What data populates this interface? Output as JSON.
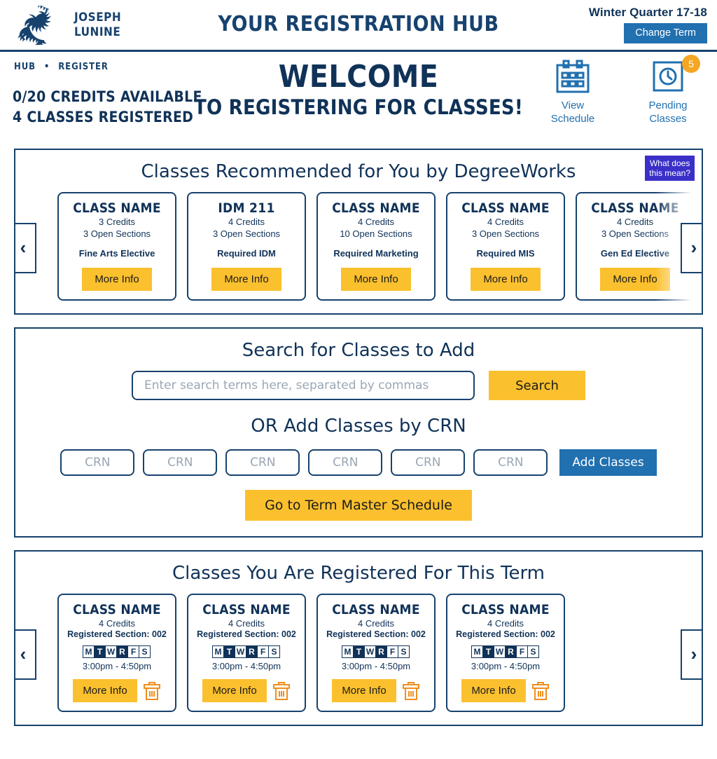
{
  "topbar": {
    "logo_icon": "dragon-logo",
    "brand_line1": "JOSEPH",
    "brand_line2": "LUNINE",
    "app_title": "YOUR REGISTRATION HUB",
    "term": "Winter Quarter 17-18",
    "change_term_label": "Change Term"
  },
  "header": {
    "breadcrumb": {
      "home": "HUB",
      "separator": "•",
      "current": "REGISTER"
    },
    "credits_line1": "0/20 CREDITS AVAILABLE",
    "credits_line2": "4 CLASSES REGISTERED",
    "welcome_line1": "WELCOME",
    "welcome_line2": "TO REGISTERING FOR CLASSES!",
    "quicklinks": [
      {
        "icon": "calendar-icon",
        "label_line1": "View",
        "label_line2": "Schedule",
        "badge": null
      },
      {
        "icon": "clock-icon",
        "label_line1": "Pending",
        "label_line2": "Classes",
        "badge": "5"
      }
    ]
  },
  "recommended": {
    "title": "Classes Recommended for You by DegreeWorks",
    "hint_line1": "What does",
    "hint_line2": "this mean?",
    "prev_label": "‹",
    "next_label": "›",
    "more_info_label": "More Info",
    "cards": [
      {
        "name": "CLASS NAME",
        "credits": "3 Credits",
        "sections": "3 Open Sections",
        "category": "Fine Arts Elective"
      },
      {
        "name": "IDM 211",
        "credits": "4 Credits",
        "sections": "3 Open Sections",
        "category": "Required IDM"
      },
      {
        "name": "CLASS NAME",
        "credits": "4 Credits",
        "sections": "10 Open Sections",
        "category": "Required Marketing"
      },
      {
        "name": "CLASS NAME",
        "credits": "4 Credits",
        "sections": "3 Open Sections",
        "category": "Required MIS"
      },
      {
        "name": "CLASS NAME",
        "credits": "4 Credits",
        "sections": "3 Open Sections",
        "category": "Gen Ed Elective"
      }
    ]
  },
  "search": {
    "title": "Search for Classes to Add",
    "placeholder": "Enter search terms here, separated by commas",
    "value": "",
    "search_label": "Search",
    "crn_title": "OR Add Classes by CRN",
    "crn_placeholder": "CRN",
    "crn_count": 6,
    "add_classes_label": "Add Classes",
    "master_schedule_label": "Go to Term Master Schedule"
  },
  "registered": {
    "title": "Classes You Are Registered For This Term",
    "prev_label": "‹",
    "next_label": "›",
    "more_info_label": "More Info",
    "delete_icon": "trash-icon",
    "day_letters": [
      "M",
      "T",
      "W",
      "R",
      "F",
      "S"
    ],
    "cards": [
      {
        "name": "CLASS NAME",
        "credits": "4 Credits",
        "section_label": "Registered Section:",
        "section": "002",
        "days_active": [
          false,
          true,
          false,
          true,
          false,
          false
        ],
        "time": "3:00pm - 4:50pm"
      },
      {
        "name": "CLASS NAME",
        "credits": "4 Credits",
        "section_label": "Registered Section:",
        "section": "002",
        "days_active": [
          false,
          true,
          false,
          true,
          false,
          false
        ],
        "time": "3:00pm - 4:50pm"
      },
      {
        "name": "CLASS NAME",
        "credits": "4 Credits",
        "section_label": "Registered Section:",
        "section": "002",
        "days_active": [
          false,
          true,
          false,
          true,
          false,
          false
        ],
        "time": "3:00pm - 4:50pm"
      },
      {
        "name": "CLASS NAME",
        "credits": "4 Credits",
        "section_label": "Registered Section:",
        "section": "002",
        "days_active": [
          false,
          true,
          false,
          true,
          false,
          false
        ],
        "time": "3:00pm - 4:50pm"
      }
    ]
  },
  "colors": {
    "navy": "#103258",
    "border_navy": "#17426e",
    "blue_button": "#2170b0",
    "yellow": "#fbc02d",
    "orange": "#f5a623",
    "purple": "#3b2fc9"
  }
}
